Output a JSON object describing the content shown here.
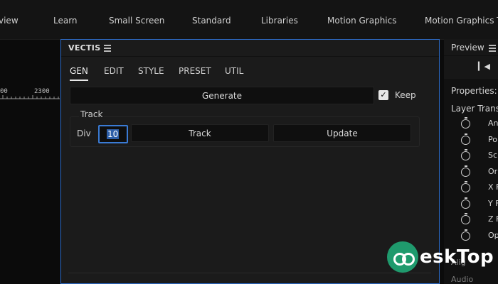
{
  "workspaces": [
    "view",
    "Learn",
    "Small Screen",
    "Standard",
    "Libraries",
    "Motion Graphics",
    "Motion Graphics Te"
  ],
  "timeline": {
    "tick_labels": [
      "00",
      "2300"
    ]
  },
  "vectis_panel": {
    "title": "VECTIS",
    "tabs": [
      "GEN",
      "EDIT",
      "STYLE",
      "PRESET",
      "UTIL"
    ],
    "active_tab": "GEN",
    "generate_label": "Generate",
    "keep_label": "Keep",
    "keep_checked": true,
    "track_group_label": "Track",
    "div_label": "Div",
    "div_value": "10",
    "track_button_label": "Track",
    "update_button_label": "Update"
  },
  "right_panel": {
    "preview_title": "Preview",
    "properties_label": "Properties: N",
    "layer_transform_label": "Layer Transf",
    "properties": [
      "An",
      "Po",
      "Sc",
      "Or",
      "X F",
      "Y F",
      "Z F",
      "Op"
    ],
    "align_label": "Alig",
    "audio_label": "Audio"
  },
  "watermark": {
    "text": "eskTop"
  },
  "colors": {
    "accent": "#2d6cc8",
    "panel_bg": "#1b1b1b",
    "watermark_green": "#1f9a6d"
  }
}
